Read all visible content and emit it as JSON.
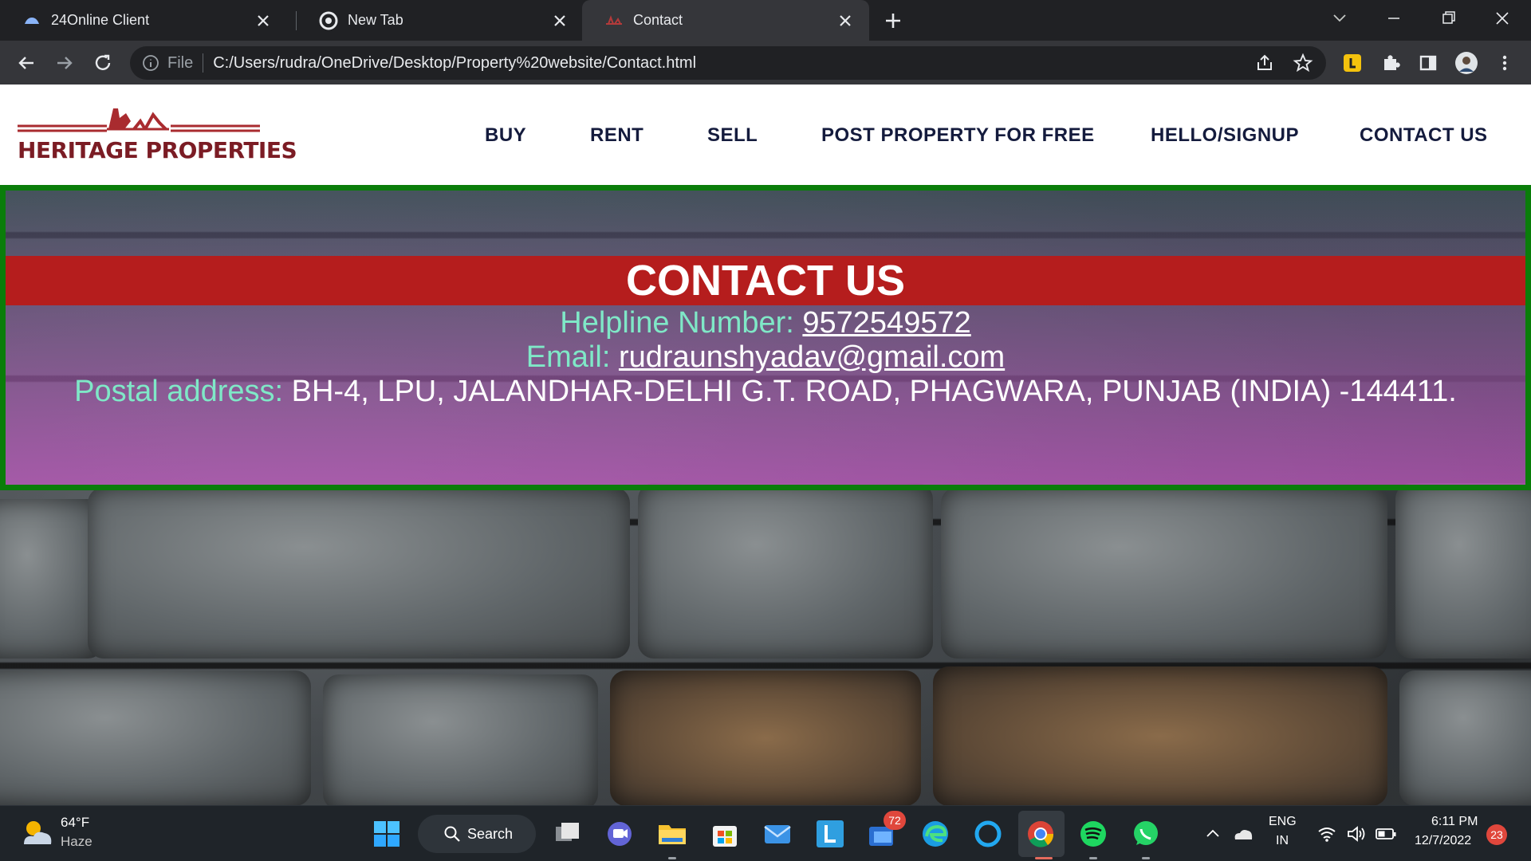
{
  "browser": {
    "tabs": [
      {
        "title": "24Online Client",
        "icon": "cloud-favicon-icon"
      },
      {
        "title": "New Tab",
        "icon": "chrome-icon"
      },
      {
        "title": "Contact",
        "icon": "heritage-favicon-icon"
      }
    ],
    "address_scheme": "File",
    "address_url": "C:/Users/rudra/OneDrive/Desktop/Property%20website/Contact.html"
  },
  "site": {
    "logo_text": "HERITAGE PROPERTIES",
    "nav": [
      "BUY",
      "RENT",
      "SELL",
      "POST PROPERTY FOR FREE",
      "HELLO/SIGNUP",
      "CONTACT US"
    ],
    "contact": {
      "heading": "CONTACT US",
      "helpline_label": "Helpline Number:",
      "helpline_value": "9572549572",
      "email_label": "Email:",
      "email_value": "rudraunshyadav@gmail.com",
      "postal_label": "Postal address:",
      "postal_value": "BH-4, LPU, JALANDHAR-DELHI G.T. ROAD, PHAGWARA, PUNJAB (INDIA) -144411."
    },
    "colors": {
      "heading_bar": "#b51d1d",
      "border": "#0a7d0a",
      "label": "#7fe8c7",
      "brand": "#7b1c24"
    }
  },
  "taskbar": {
    "weather_temp": "64°F",
    "weather_desc": "Haze",
    "search_label": "Search",
    "mail_badge": "72",
    "lang_top": "ENG",
    "lang_bottom": "IN",
    "time": "6:11 PM",
    "date": "12/7/2022",
    "notification_count": "23"
  }
}
